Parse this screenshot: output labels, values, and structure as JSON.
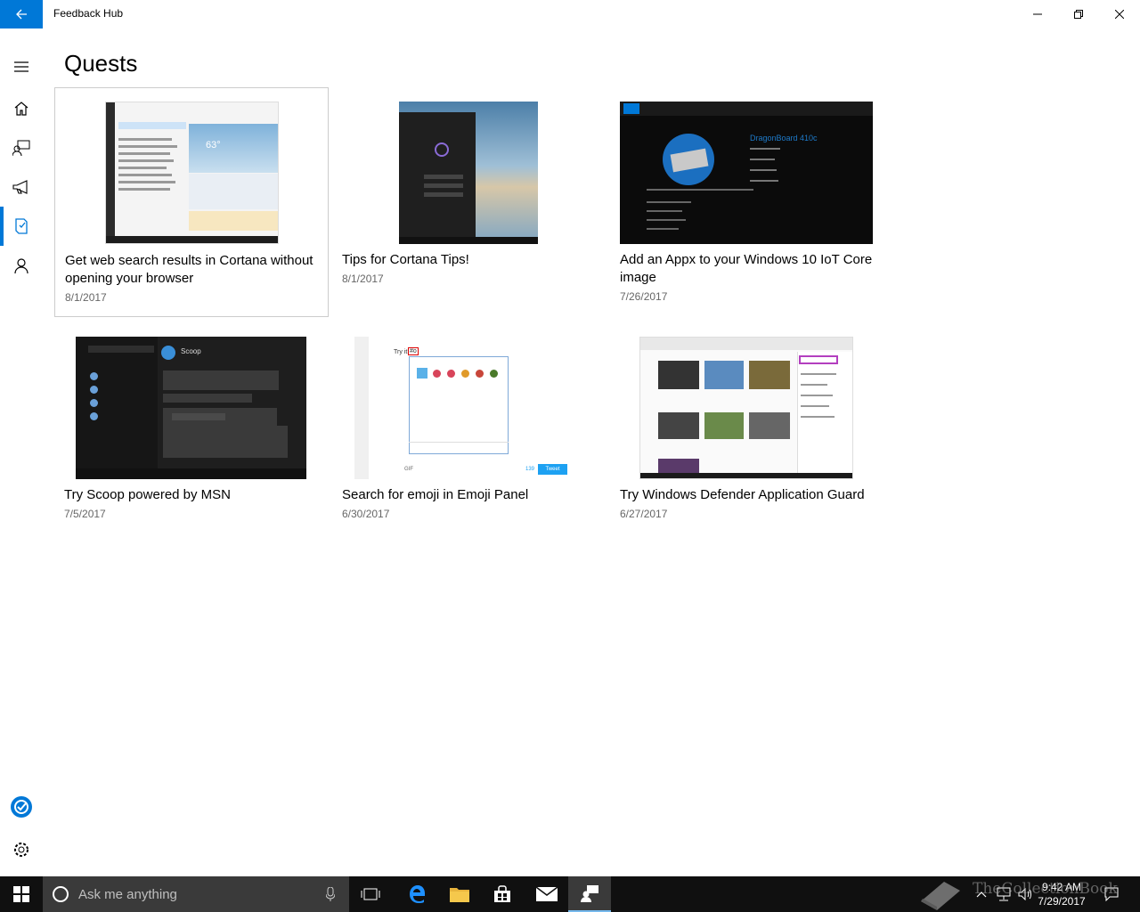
{
  "window": {
    "title": "Feedback Hub"
  },
  "page": {
    "title": "Quests"
  },
  "quests": [
    {
      "title": "Get web search results in Cortana without opening your browser",
      "date": "8/1/2017"
    },
    {
      "title": "Tips for Cortana Tips!",
      "date": "8/1/2017"
    },
    {
      "title": "Add an Appx to your Windows 10 IoT Core image",
      "date": "7/26/2017"
    },
    {
      "title": "Try Scoop powered by MSN",
      "date": "7/5/2017"
    },
    {
      "title": "Search for emoji in Emoji Panel",
      "date": "6/30/2017"
    },
    {
      "title": "Try Windows Defender Application Guard",
      "date": "6/27/2017"
    }
  ],
  "thumbnails": {
    "cortana_temp": "63°",
    "iot_heading": "DragonBoard 410c",
    "emoji_prompt": "Try it!",
    "emoji_typed": "#o",
    "emoji_tweet": "Tweet",
    "emoji_gif": "GIF",
    "emoji_count": "139",
    "scoop_name": "Scoop"
  },
  "taskbar": {
    "search_placeholder": "Ask me anything",
    "time": "9:42 AM",
    "date": "7/29/2017"
  },
  "watermark": {
    "text": "TheCollectionBook"
  },
  "colors": {
    "accent": "#0078d7",
    "taskbar": "#101010",
    "search_box": "#3a3a3a"
  }
}
